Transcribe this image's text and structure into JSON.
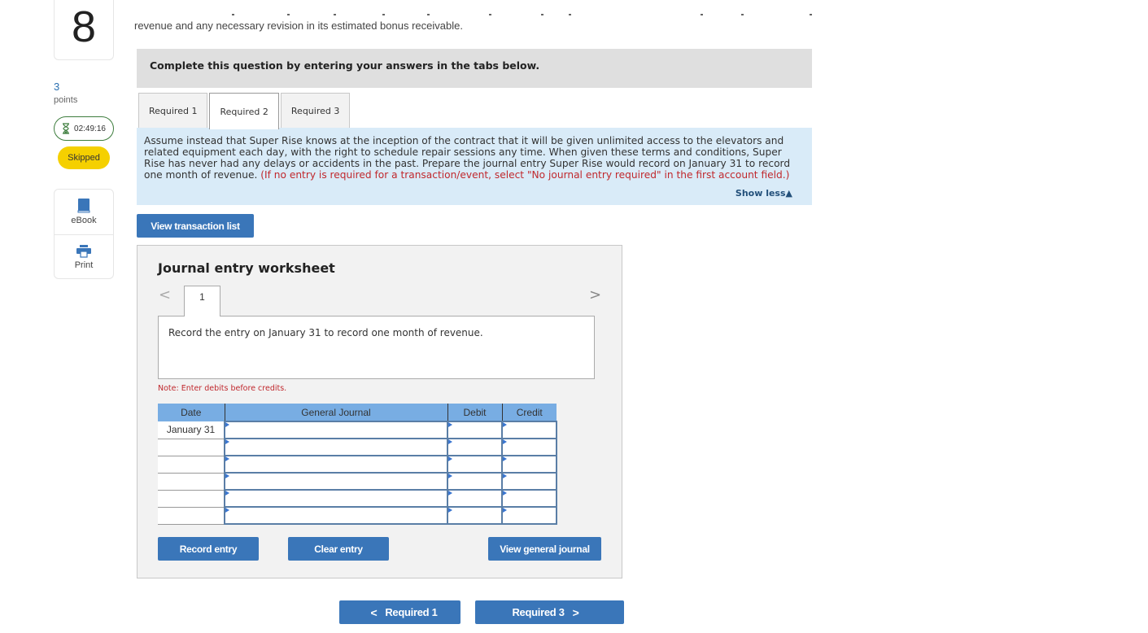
{
  "question": {
    "number": "8",
    "points_value": "3",
    "points_label": "points",
    "timer": "02:49:16",
    "status_badge": "Skipped",
    "intro_text": "revenue and any necessary revision in its estimated bonus receivable."
  },
  "tools": [
    {
      "label": "eBook",
      "icon": "book-icon"
    },
    {
      "label": "Print",
      "icon": "printer-icon"
    }
  ],
  "instructions": "Complete this question by entering your answers in the tabs below.",
  "tabs": [
    {
      "label": "Required 1",
      "active": false
    },
    {
      "label": "Required 2",
      "active": true
    },
    {
      "label": "Required 3",
      "active": false
    }
  ],
  "prompt": {
    "text": "Assume instead that Super Rise knows at the inception of the contract that it will be given unlimited access to the elevators and related equipment each day, with the right to schedule repair sessions any time. When given these terms and conditions, Super Rise has never had any delays or accidents in the past. Prepare the journal entry Super Rise would record on January 31 to record one month of revenue.",
    "note": "(If no entry is required for a transaction/event, select \"No journal entry required\" in the first account field.)",
    "show_less": "Show less"
  },
  "buttons": {
    "view_transaction_list": "View transaction list",
    "record_entry": "Record entry",
    "clear_entry": "Clear entry",
    "view_general_journal": "View general journal",
    "prev_required": "Required 1",
    "next_required": "Required 3"
  },
  "worksheet": {
    "title": "Journal entry worksheet",
    "current_page": "1",
    "description": "Record the entry on January 31 to record one month of revenue.",
    "note": "Note: Enter debits before credits.",
    "columns": [
      "Date",
      "General Journal",
      "Debit",
      "Credit"
    ],
    "rows": [
      {
        "date": "January 31",
        "account": "",
        "debit": "",
        "credit": ""
      },
      {
        "date": "",
        "account": "",
        "debit": "",
        "credit": ""
      },
      {
        "date": "",
        "account": "",
        "debit": "",
        "credit": ""
      },
      {
        "date": "",
        "account": "",
        "debit": "",
        "credit": ""
      },
      {
        "date": "",
        "account": "",
        "debit": "",
        "credit": ""
      },
      {
        "date": "",
        "account": "",
        "debit": "",
        "credit": ""
      }
    ]
  },
  "colors": {
    "primary_button": "#3a76b9",
    "table_header": "#78ade3",
    "prompt_bg": "#d9ebf8",
    "warning_red": "#c0282d",
    "skipped_badge": "#f5d000",
    "timer_border": "#3d7d3d"
  }
}
